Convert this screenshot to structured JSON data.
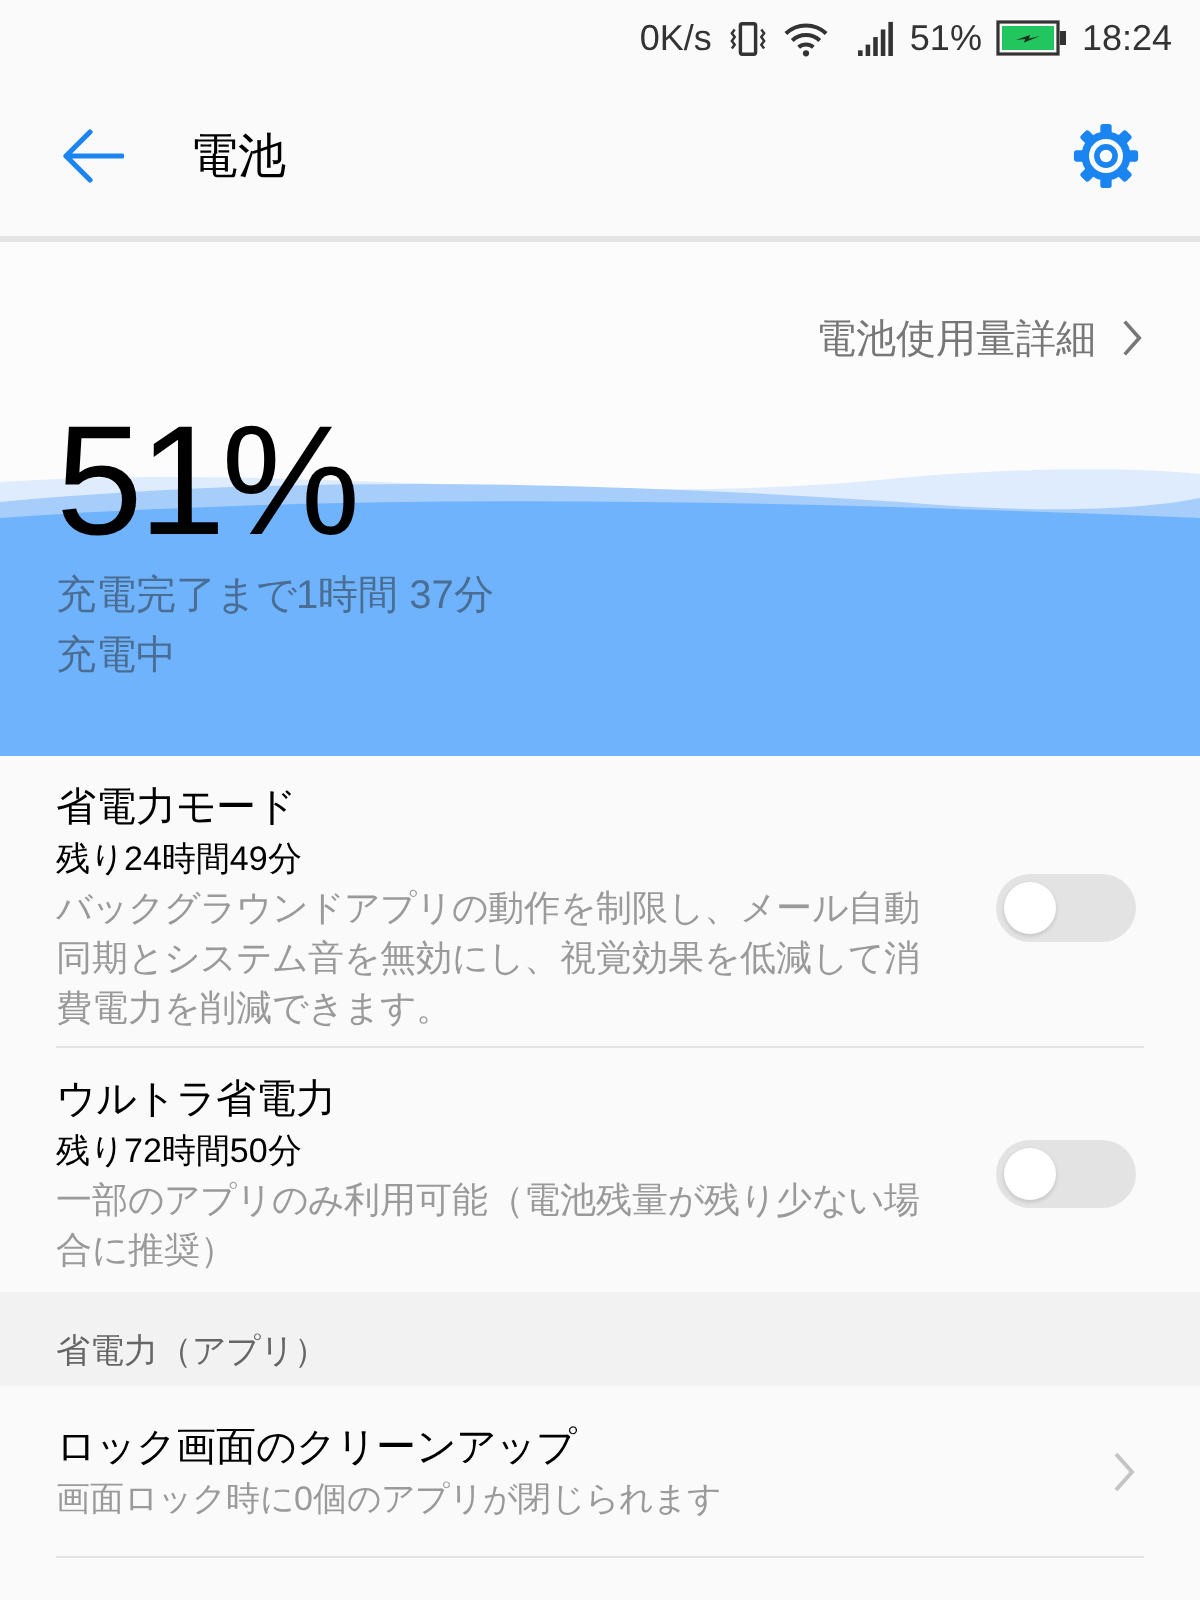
{
  "status_bar": {
    "network_speed": "0K/s",
    "battery_percent": "51%",
    "time": "18:24"
  },
  "header": {
    "title": "電池"
  },
  "usage_details_link": {
    "label": "電池使用量詳細"
  },
  "battery": {
    "percent": "51%",
    "time_to_full": "充電完了まで1時間 37分",
    "status": "充電中"
  },
  "power_modes": [
    {
      "title": "省電力モード",
      "remaining": "残り24時間49分",
      "description": "バックグラウンドアプリの動作を制限し、メール自動同期とシステム音を無効にし、視覚効果を低減して消費電力を削減できます。",
      "on": false
    },
    {
      "title": "ウルトラ省電力",
      "remaining": "残り72時間50分",
      "description": "一部のアプリのみ利用可能（電池残量が残り少ない場合に推奨）",
      "on": false
    }
  ],
  "sections": [
    {
      "header": "省電力（アプリ）",
      "items": [
        {
          "title": "ロック画面のクリーンアップ",
          "subtitle": "画面ロック時に0個のアプリが閉じられます"
        }
      ]
    }
  ]
}
